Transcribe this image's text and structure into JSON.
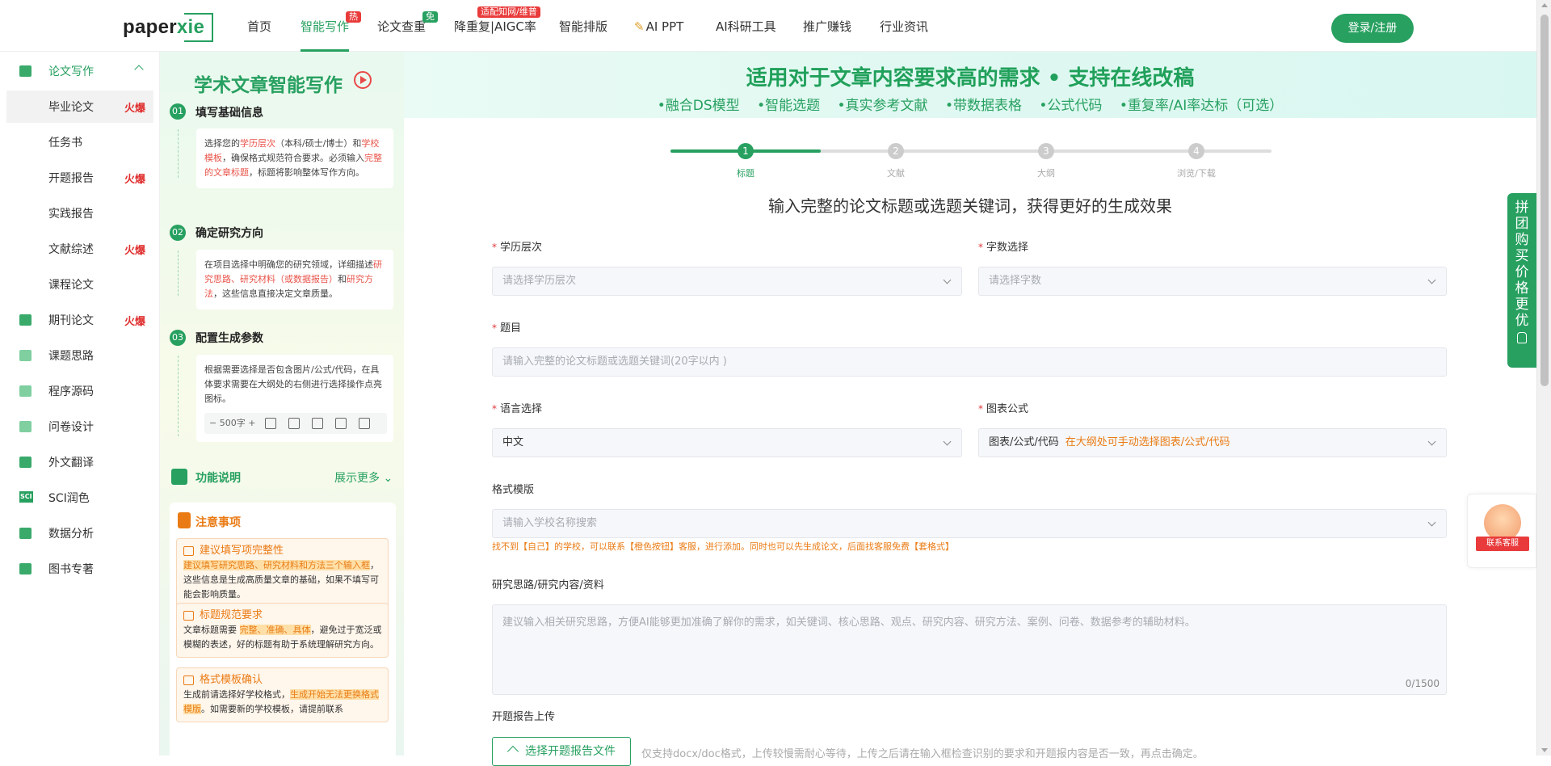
{
  "brand": {
    "logo_main": "paper",
    "logo_accent": "xie"
  },
  "nav": {
    "items": [
      {
        "label": "首页"
      },
      {
        "label": "智能写作",
        "badge": "热"
      },
      {
        "label": "论文查重",
        "badge": "免"
      },
      {
        "label": "降重复|AIGC率",
        "badge": "适配知网/维普"
      },
      {
        "label": "智能排版"
      },
      {
        "label": "AI PPT"
      },
      {
        "label": "AI科研工具"
      },
      {
        "label": "推广赚钱"
      },
      {
        "label": "行业资讯"
      }
    ],
    "login_label": "登录/注册"
  },
  "sidebar": {
    "items": [
      {
        "label": "论文写作",
        "type": "category"
      },
      {
        "label": "毕业论文",
        "hot": "火爆"
      },
      {
        "label": "任务书"
      },
      {
        "label": "开题报告",
        "hot": "火爆"
      },
      {
        "label": "实践报告"
      },
      {
        "label": "文献综述",
        "hot": "火爆"
      },
      {
        "label": "课程论文"
      },
      {
        "label": "期刊论文",
        "hot": "火爆"
      },
      {
        "label": "课题思路"
      },
      {
        "label": "程序源码"
      },
      {
        "label": "问卷设计"
      },
      {
        "label": "外文翻译"
      },
      {
        "label": "SCI润色",
        "icon_text": "SCI"
      },
      {
        "label": "数据分析"
      },
      {
        "label": "图书专著"
      }
    ]
  },
  "guide": {
    "title": "学术文章智能写作",
    "steps": [
      {
        "num": "01",
        "title": "填写基础信息",
        "t1": "选择您的",
        "e1": "学历层次",
        "t2": "（本科/硕士/博士）和",
        "e2": "学校模板",
        "t3": "，确保格式规范符合要求。必须输入",
        "e3": "完整的文章标题",
        "t4": "，标题将影响整体写作方向。"
      },
      {
        "num": "02",
        "title": "确定研究方向",
        "t1": "在项目选择中明确您的研究领域，详细描述",
        "e1": "研究思路、研究材料（或数据报告）",
        "t2": "和",
        "e2": "研究方法",
        "t3": "，这些信息直接决定文章质量。"
      },
      {
        "num": "03",
        "title": "配置生成参数",
        "text": "根据需要选择是否包含图片/公式/代码，在具体要求需要在大纲处的右侧进行选择操作点亮图标。",
        "stepper": "− 500字 +"
      }
    ],
    "func_label": "功能说明",
    "func_more": "展示更多",
    "notes_title": "注意事项",
    "notes": [
      {
        "title": "建议填写项完整性",
        "hl": "建议填写研究思路、研究材料和方法三个输入框",
        "text": "，这些信息是生成高质量文章的基础，如果不填写可能会影响质量。"
      },
      {
        "title": "标题规范要求",
        "t1": "文章标题需要 ",
        "hl": "完整、准确、具体",
        "t2": "，避免过于宽泛或模糊的表述，好的标题有助于系统理解研究方向。"
      },
      {
        "title": "格式模板确认",
        "t1": "生成前请选择好学校格式，",
        "hl": "生成开始无法更换格式模版",
        "t2": "。如需要新的学校模板，请提前联系"
      }
    ]
  },
  "main": {
    "banner_title": "适用对于文章内容要求高的需求 • 支持在线改稿",
    "features": [
      "•融合DS模型",
      "•智能选题",
      "•真实参考文献",
      "•带数据表格",
      "•公式代码",
      "•重复率/AI率达标（可选）"
    ],
    "steps": [
      {
        "num": "1",
        "label": "标题"
      },
      {
        "num": "2",
        "label": "文献"
      },
      {
        "num": "3",
        "label": "大纲"
      },
      {
        "num": "4",
        "label": "浏览/下载"
      }
    ],
    "progress": 0.25,
    "prompt": "输入完整的论文标题或选题关键词，获得更好的生成效果",
    "form": {
      "degree_label": "学历层次",
      "degree_placeholder": "请选择学历层次",
      "words_label": "字数选择",
      "words_placeholder": "请选择字数",
      "topic_label": "题目",
      "topic_placeholder": "请输入完整的论文标题或选题关键词(20字以内 )",
      "lang_label": "语言选择",
      "lang_value": "中文",
      "chart_label": "图表公式",
      "chart_value": "图表/公式/代码",
      "chart_hint": "在大纲处可手动选择图表/公式/代码",
      "template_label": "格式模版",
      "template_placeholder": "请输入学校名称搜索",
      "template_warn": "找不到【自己】的学校，可以联系【橙色按钮】客服，进行添加。同时也可以先生成论文，后面找客服免费【套格式】",
      "research_label": "研究思路/研究内容/资料",
      "research_placeholder": "建议输入相关研究思路，方便AI能够更加准确了解你的需求，如关键词、核心思路、观点、研究内容、研究方法、案例、问卷、数据参考的辅助材料。",
      "research_counter": "0/1500",
      "upload_label": "开题报告上传",
      "upload_button": "选择开题报告文件",
      "upload_note": "仅支持docx/doc格式，上传较慢需耐心等待，上传之后请在输入框检查识别的要求和开题报内容是否一致，再点击确定。"
    }
  },
  "widgets": {
    "promo": "拼团购买 价格更优",
    "service": "联系客服"
  },
  "colors": {
    "brand_green": "#27a060",
    "hot_red": "#e02f2f",
    "note_orange": "#ea7b14"
  }
}
